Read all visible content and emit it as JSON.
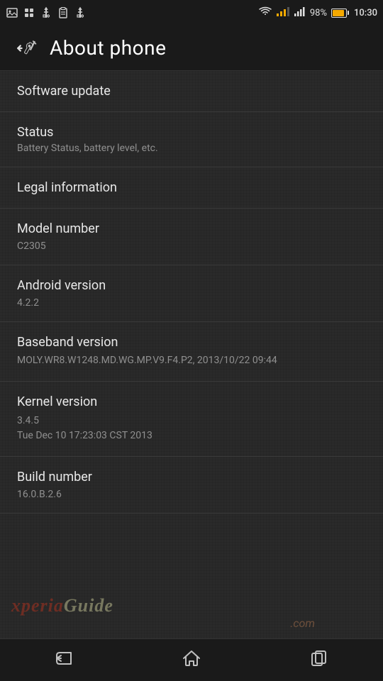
{
  "statusBar": {
    "batteryPercent": "98%",
    "time": "10:30",
    "icons": [
      "image",
      "bb",
      "usb",
      "task",
      "usb2"
    ]
  },
  "header": {
    "title": "About phone",
    "backArrow": "←"
  },
  "menuItems": [
    {
      "id": "software-update",
      "title": "Software update",
      "subtitle": "",
      "value": ""
    },
    {
      "id": "status",
      "title": "Status",
      "subtitle": "Battery Status, battery level, etc.",
      "value": ""
    },
    {
      "id": "legal-information",
      "title": "Legal information",
      "subtitle": "",
      "value": ""
    },
    {
      "id": "model-number",
      "title": "Model number",
      "subtitle": "",
      "value": "C2305"
    },
    {
      "id": "android-version",
      "title": "Android version",
      "subtitle": "",
      "value": "4.2.2"
    },
    {
      "id": "baseband-version",
      "title": "Baseband version",
      "subtitle": "",
      "value": "MOLY.WR8.W1248.MD.WG.MP.V9.F4.P2, 2013/10/22 09:44"
    },
    {
      "id": "kernel-version",
      "title": "Kernel version",
      "subtitle": "",
      "value": "3.4.5\nTue Dec 10 17:23:03 CST 2013"
    },
    {
      "id": "build-number",
      "title": "Build number",
      "subtitle": "",
      "value": "16.0.B.2.6"
    }
  ],
  "bottomNav": {
    "back": "↩",
    "home": "⌂",
    "recents": "▭"
  },
  "watermark": {
    "brand": "XperiaGuide",
    "tld": ".com"
  }
}
